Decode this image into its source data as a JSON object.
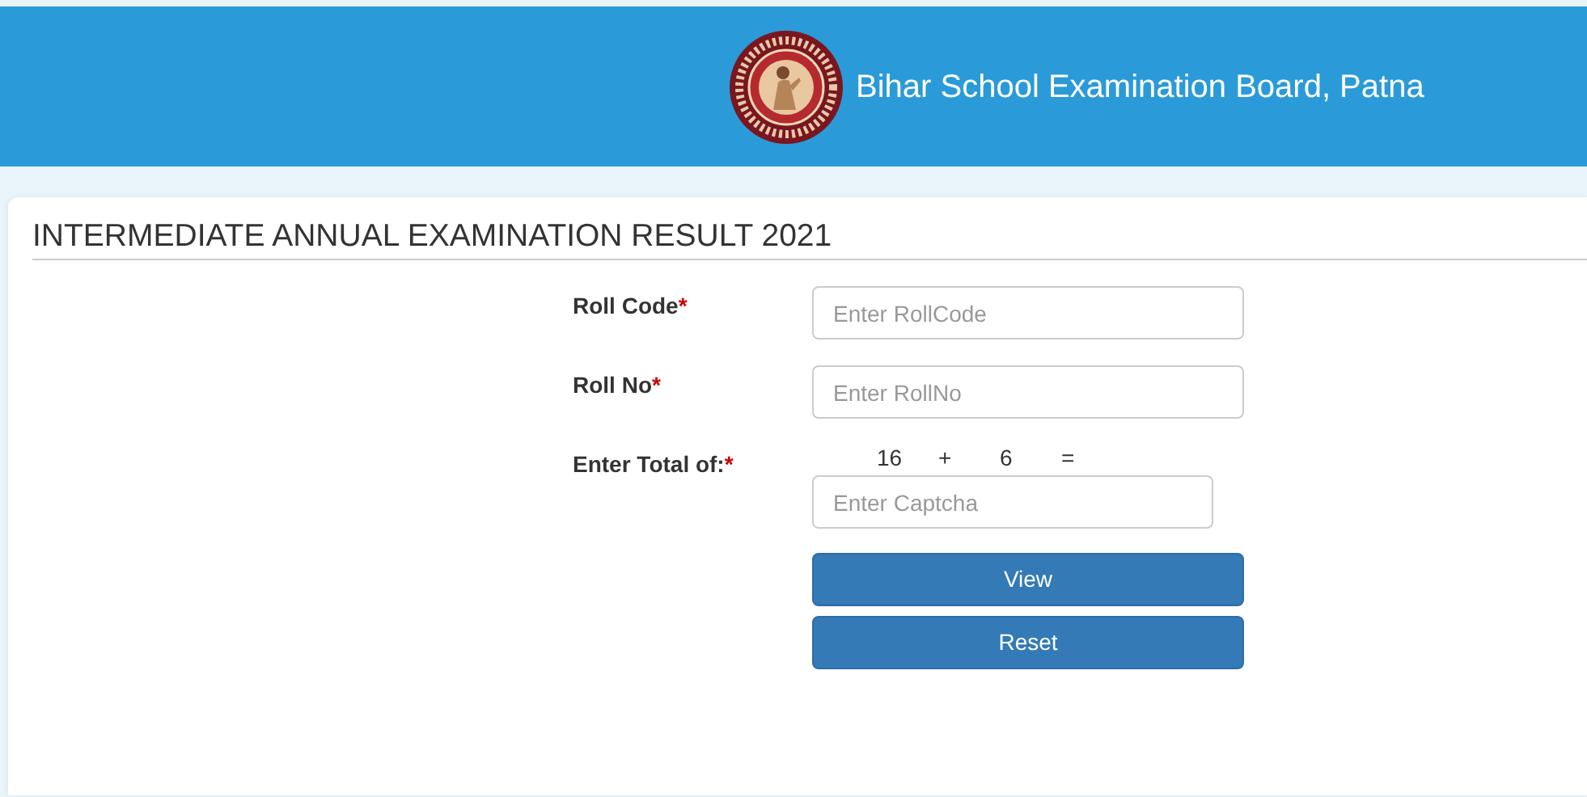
{
  "header": {
    "title": "Bihar School Examination Board, Patna"
  },
  "page_title": "INTERMEDIATE ANNUAL EXAMINATION RESULT 2021",
  "fields": [
    {
      "kind": "text",
      "label": "Roll Code",
      "required_mark": "*",
      "placeholder": "Enter RollCode"
    },
    {
      "kind": "text",
      "label": "Roll No",
      "required_mark": "*",
      "placeholder": "Enter RollNo"
    },
    {
      "kind": "captcha",
      "label": "Enter Total of:",
      "required_mark": "*",
      "captcha": [
        "16",
        "+",
        "6",
        "="
      ],
      "placeholder": "Enter Captcha"
    }
  ],
  "buttons": [
    "View",
    "Reset"
  ]
}
